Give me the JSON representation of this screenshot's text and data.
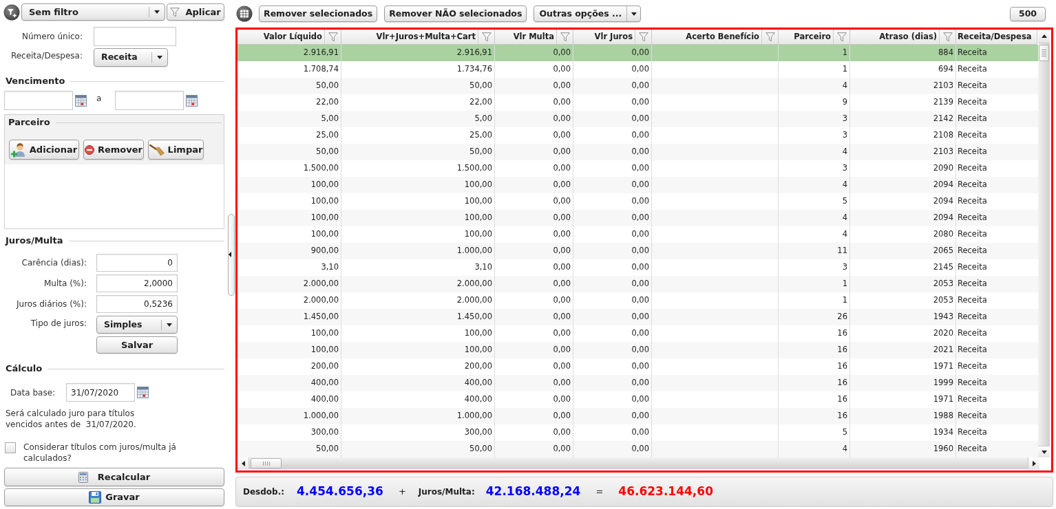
{
  "filter_bar": {
    "filter": "Sem filtro",
    "apply": "Aplicar"
  },
  "search": {
    "numero_unico": {
      "label": "Número único:"
    },
    "receita_despesa": {
      "label": "Receita/Despesa:",
      "value": "Receita"
    }
  },
  "vencimento": {
    "title": "Vencimento",
    "separator": "a"
  },
  "parceiro": {
    "title": "Parceiro",
    "buttons": [
      "Adicionar",
      "Remover",
      "Limpar"
    ]
  },
  "juros_multa": {
    "title": "Juros/Multa",
    "fields": [
      {
        "label": "Carência (dias):",
        "value": "0"
      },
      {
        "label": "Multa (%):",
        "value": "2,0000"
      },
      {
        "label": "Juros diários (%):",
        "value": "0,5236"
      }
    ],
    "tipo_juros": {
      "label": "Tipo de juros:",
      "value": "Simples"
    },
    "save": "Salvar"
  },
  "calculo": {
    "title": "Cálculo",
    "data_base": {
      "label": "Data base:",
      "value": "31/07/2020"
    },
    "note": "Será calculado juro para títulos vencidos antes de  31/07/2020.",
    "consider": {
      "label": "Considerar títulos com juros/multa já calculados?",
      "checked": false
    },
    "recalcular": "Recalcular",
    "gravar": "Gravar"
  },
  "toolbar": {
    "buttons": [
      "Remover selecionados",
      "Remover NÃO selecionados"
    ],
    "options": "Outras opções ...",
    "limit": "500"
  },
  "table": {
    "columns": [
      {
        "label": "Valor Líquido",
        "filter": true
      },
      {
        "label": "Vlr+Juros+Multa+Cart",
        "filter": true
      },
      {
        "label": "Vlr Multa",
        "filter": true
      },
      {
        "label": "Vlr Juros",
        "filter": true
      },
      {
        "label": "Acerto Benefício",
        "filter": true
      },
      {
        "label": "Parceiro",
        "filter": true
      },
      {
        "label": "Atraso (dias)",
        "filter": true
      },
      {
        "label": "Receita/Despesa",
        "filter": false
      }
    ],
    "rows": [
      {
        "selected": true,
        "cells": [
          "2.916,91",
          "2.916,91",
          "0,00",
          "0,00",
          null,
          "1",
          "884",
          "Receita"
        ]
      },
      {
        "selected": false,
        "cells": [
          "1.708,74",
          "1.734,76",
          "0,00",
          "0,00",
          null,
          "1",
          "694",
          "Receita"
        ]
      },
      {
        "selected": false,
        "cells": [
          "50,00",
          "50,00",
          "0,00",
          "0,00",
          null,
          "4",
          "2103",
          "Receita"
        ]
      },
      {
        "selected": false,
        "cells": [
          "22,00",
          "22,00",
          "0,00",
          "0,00",
          null,
          "9",
          "2139",
          "Receita"
        ]
      },
      {
        "selected": false,
        "cells": [
          "5,00",
          "5,00",
          "0,00",
          "0,00",
          null,
          "3",
          "2142",
          "Receita"
        ]
      },
      {
        "selected": false,
        "cells": [
          "25,00",
          "25,00",
          "0,00",
          "0,00",
          null,
          "3",
          "2108",
          "Receita"
        ]
      },
      {
        "selected": false,
        "cells": [
          "50,00",
          "50,00",
          "0,00",
          "0,00",
          null,
          "4",
          "2103",
          "Receita"
        ]
      },
      {
        "selected": false,
        "cells": [
          "1.500,00",
          "1.500,00",
          "0,00",
          "0,00",
          null,
          "3",
          "2090",
          "Receita"
        ]
      },
      {
        "selected": false,
        "cells": [
          "100,00",
          "100,00",
          "0,00",
          "0,00",
          null,
          "4",
          "2094",
          "Receita"
        ]
      },
      {
        "selected": false,
        "cells": [
          "100,00",
          "100,00",
          "0,00",
          "0,00",
          null,
          "5",
          "2094",
          "Receita"
        ]
      },
      {
        "selected": false,
        "cells": [
          "100,00",
          "100,00",
          "0,00",
          "0,00",
          null,
          "4",
          "2094",
          "Receita"
        ]
      },
      {
        "selected": false,
        "cells": [
          "100,00",
          "100,00",
          "0,00",
          "0,00",
          null,
          "4",
          "2080",
          "Receita"
        ]
      },
      {
        "selected": false,
        "cells": [
          "900,00",
          "1.000,00",
          "0,00",
          "0,00",
          null,
          "11",
          "2065",
          "Receita"
        ]
      },
      {
        "selected": false,
        "cells": [
          "3,10",
          "3,10",
          "0,00",
          "0,00",
          null,
          "3",
          "2145",
          "Receita"
        ]
      },
      {
        "selected": false,
        "cells": [
          "2.000,00",
          "2.000,00",
          "0,00",
          "0,00",
          null,
          "1",
          "2053",
          "Receita"
        ]
      },
      {
        "selected": false,
        "cells": [
          "2.000,00",
          "2.000,00",
          "0,00",
          "0,00",
          null,
          "1",
          "2053",
          "Receita"
        ]
      },
      {
        "selected": false,
        "cells": [
          "1.450,00",
          "1.450,00",
          "0,00",
          "0,00",
          null,
          "26",
          "1943",
          "Receita"
        ]
      },
      {
        "selected": false,
        "cells": [
          "100,00",
          "100,00",
          "0,00",
          "0,00",
          null,
          "16",
          "2020",
          "Receita"
        ]
      },
      {
        "selected": false,
        "cells": [
          "100,00",
          "100,00",
          "0,00",
          "0,00",
          null,
          "16",
          "2021",
          "Receita"
        ]
      },
      {
        "selected": false,
        "cells": [
          "200,00",
          "200,00",
          "0,00",
          "0,00",
          null,
          "16",
          "1971",
          "Receita"
        ]
      },
      {
        "selected": false,
        "cells": [
          "400,00",
          "400,00",
          "0,00",
          "0,00",
          null,
          "16",
          "1999",
          "Receita"
        ]
      },
      {
        "selected": false,
        "cells": [
          "400,00",
          "400,00",
          "0,00",
          "0,00",
          null,
          "16",
          "1971",
          "Receita"
        ]
      },
      {
        "selected": false,
        "cells": [
          "1.000,00",
          "1.000,00",
          "0,00",
          "0,00",
          null,
          "16",
          "1988",
          "Receita"
        ]
      },
      {
        "selected": false,
        "cells": [
          "300,00",
          "300,00",
          "0,00",
          "0,00",
          null,
          "5",
          "1934",
          "Receita"
        ]
      },
      {
        "selected": false,
        "cells": [
          "50,00",
          "50,00",
          "0,00",
          "0,00",
          null,
          "4",
          "1960",
          "Receita"
        ]
      }
    ]
  },
  "totals": {
    "desdob_label": "Desdob.:",
    "desdob": "4.454.656,36",
    "plus": "+",
    "juros_label": "Juros/Multa:",
    "juros": "42.168.488,24",
    "equals": "=",
    "total": "46.623.144,60"
  }
}
